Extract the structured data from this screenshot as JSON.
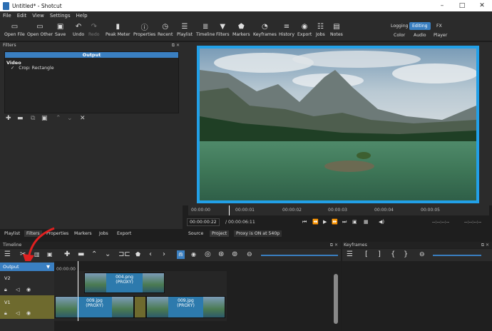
{
  "window": {
    "title": "Untitled* - Shotcut"
  },
  "menu": [
    "File",
    "Edit",
    "View",
    "Settings",
    "Help"
  ],
  "toolbar": [
    {
      "label": "Open File",
      "icon": "folder-open-icon",
      "sym": "▭"
    },
    {
      "label": "Open Other",
      "icon": "folder-other-icon",
      "sym": "▭"
    },
    {
      "label": "Save",
      "icon": "save-icon",
      "sym": "▣"
    },
    {
      "label": "Undo",
      "icon": "undo-icon",
      "sym": "↶"
    },
    {
      "label": "Redo",
      "icon": "redo-icon",
      "sym": "↷"
    },
    {
      "label": "Peak Meter",
      "icon": "peak-meter-icon",
      "sym": "▮"
    },
    {
      "label": "Properties",
      "icon": "properties-icon",
      "sym": "ⓘ"
    },
    {
      "label": "Recent",
      "icon": "recent-icon",
      "sym": "◷"
    },
    {
      "label": "Playlist",
      "icon": "playlist-icon",
      "sym": "☰"
    },
    {
      "label": "Timeline",
      "icon": "timeline-icon",
      "sym": "≣"
    },
    {
      "label": "Filters",
      "icon": "filters-icon",
      "sym": "▼"
    },
    {
      "label": "Markers",
      "icon": "markers-icon",
      "sym": "⬟"
    },
    {
      "label": "Keyframes",
      "icon": "keyframes-icon",
      "sym": "◔"
    },
    {
      "label": "History",
      "icon": "history-icon",
      "sym": "≡"
    },
    {
      "label": "Export",
      "icon": "export-icon",
      "sym": "◉"
    },
    {
      "label": "Jobs",
      "icon": "jobs-icon",
      "sym": "☷"
    },
    {
      "label": "Notes",
      "icon": "notes-icon",
      "sym": "▤"
    }
  ],
  "layouts": {
    "logging": "Logging",
    "editing": "Editing",
    "fx": "FX",
    "color": "Color",
    "audio": "Audio",
    "player": "Player"
  },
  "filters": {
    "panel_title": "Filters",
    "header": "Output",
    "section": "Video",
    "items": [
      {
        "checked": "✓",
        "name": "Crop: Rectangle"
      }
    ]
  },
  "left_tabs": [
    "Playlist",
    "Filters",
    "Properties",
    "Markers",
    "Jobs",
    "Export"
  ],
  "ruler_ticks": [
    "00:00:00",
    "00:00:01",
    "00:00:02",
    "00:00:03",
    "00:00:04",
    "00:00:05"
  ],
  "transport": {
    "position": "00:00:00:22",
    "duration": "/ 00:00:06:11",
    "in_point": "--:--:--:--",
    "out_point": "--:--:--:--"
  },
  "viewer_tabs": {
    "source": "Source",
    "project": "Project",
    "proxy_msg": "Proxy is ON at 540p"
  },
  "timeline": {
    "title": "Timeline",
    "output_label": "Output",
    "time_zero": "00:00:00",
    "tracks": [
      {
        "name": "V2",
        "clips": [
          {
            "label": "004.png",
            "proxy": "(PROXY)"
          }
        ]
      },
      {
        "name": "V1",
        "clips": [
          {
            "label": "009.jpg",
            "proxy": "(PROXY)"
          },
          {
            "label": "009.jpg",
            "proxy": "(PROXY)"
          }
        ]
      }
    ]
  },
  "keyframes": {
    "title": "Keyframes"
  },
  "colors": {
    "accent": "#3a7fc1",
    "viewer_border": "#22a0e8",
    "track_v1": "#6e6a2e",
    "annotation_arrow": "#e02020"
  }
}
